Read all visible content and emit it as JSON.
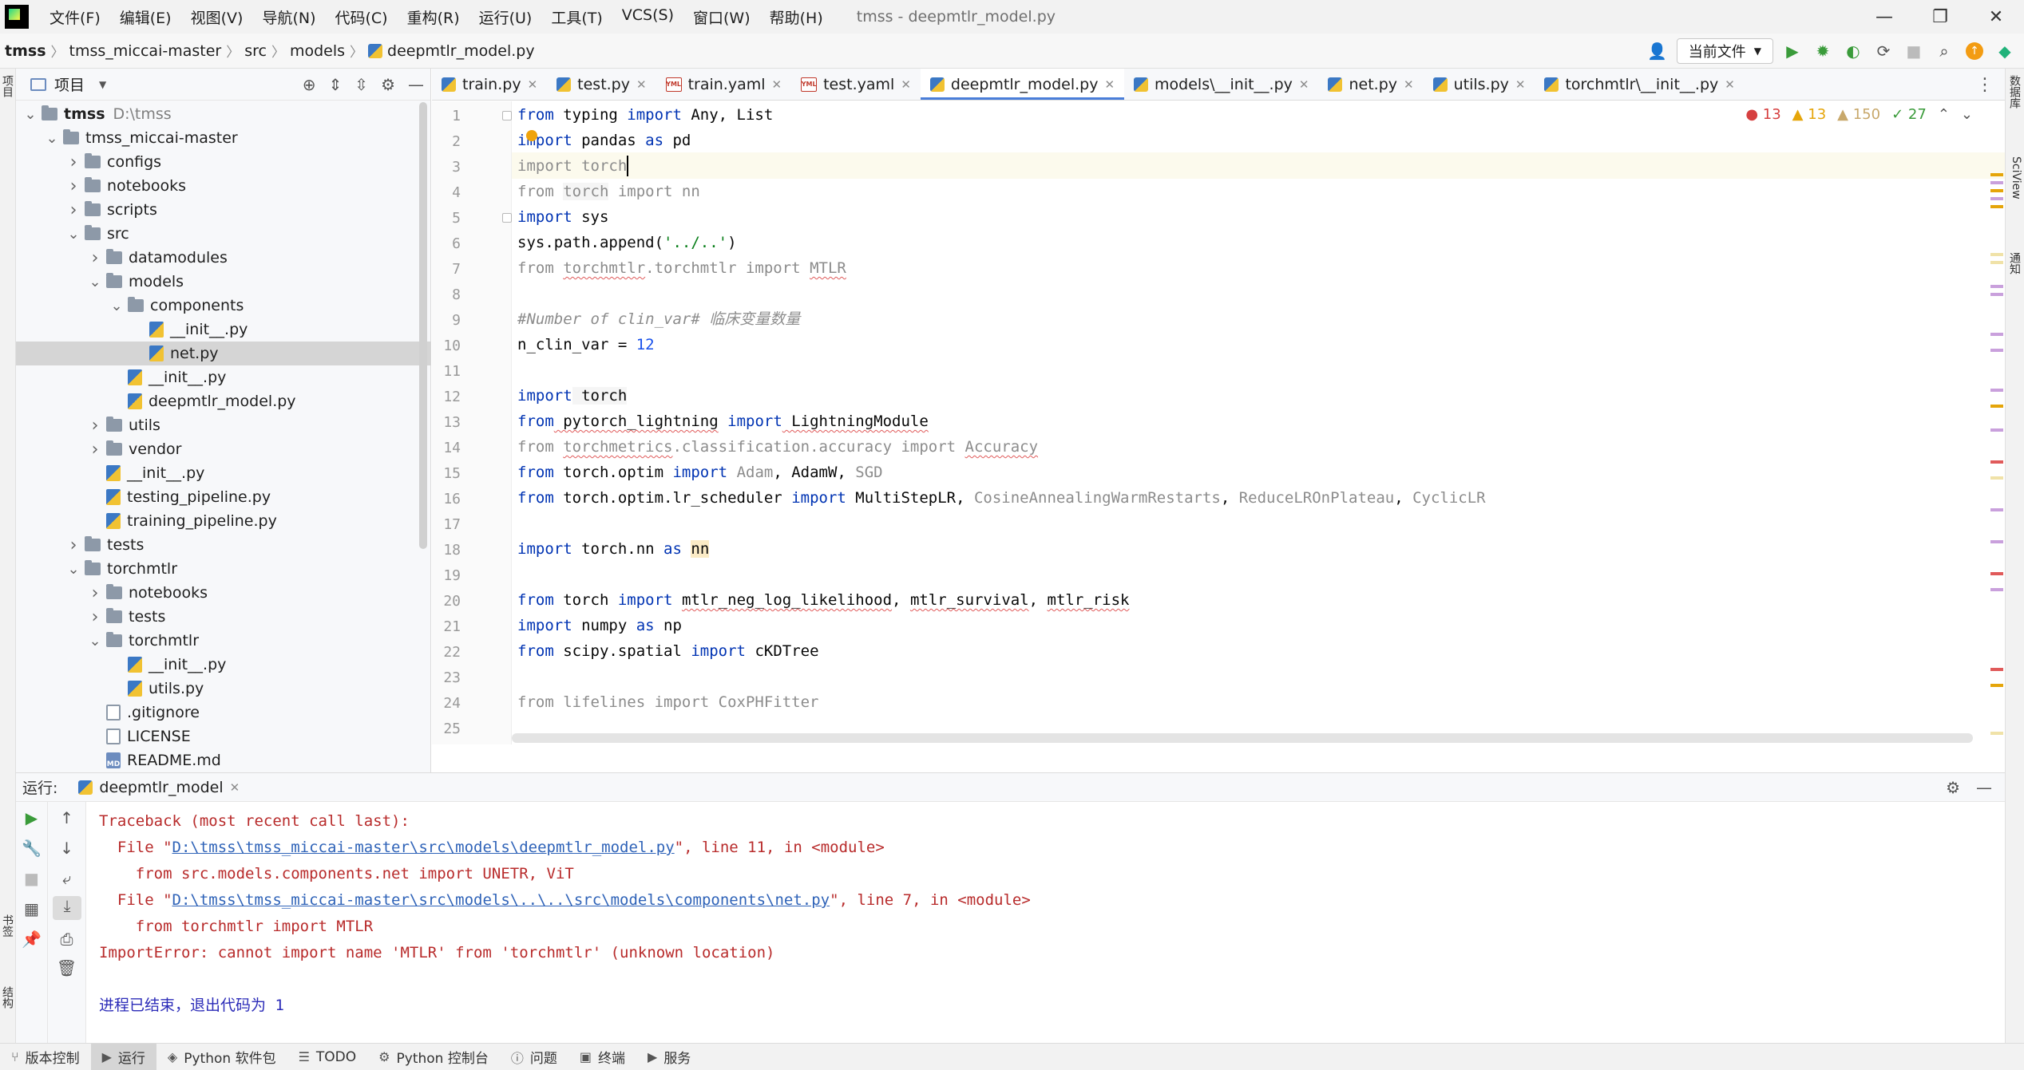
{
  "window": {
    "title": "tmss - deepmtlr_model.py",
    "menu": [
      "文件(F)",
      "编辑(E)",
      "视图(V)",
      "导航(N)",
      "代码(C)",
      "重构(R)",
      "运行(U)",
      "工具(T)",
      "VCS(S)",
      "窗口(W)",
      "帮助(H)"
    ],
    "controls": {
      "minimize": "—",
      "maximize": "❐",
      "close": "✕"
    }
  },
  "breadcrumb": [
    "tmss",
    "tmss_miccai-master",
    "src",
    "models",
    "deepmtlr_model.py"
  ],
  "toolbar": {
    "run_config": "当前文件",
    "icons": [
      "user-icon",
      "run-icon",
      "debug-icon",
      "coverage-icon",
      "profile-icon",
      "stop-icon",
      "search-icon",
      "update-icon",
      "plugin-icon"
    ]
  },
  "project_panel": {
    "title": "项目",
    "tree": [
      {
        "label": "tmss",
        "path": "D:\\tmss",
        "type": "folder",
        "depth": 0,
        "expanded": true,
        "bold": true
      },
      {
        "label": "tmss_miccai-master",
        "type": "folder",
        "depth": 1,
        "expanded": true
      },
      {
        "label": "configs",
        "type": "folder",
        "depth": 2,
        "expanded": false
      },
      {
        "label": "notebooks",
        "type": "folder",
        "depth": 2,
        "expanded": false
      },
      {
        "label": "scripts",
        "type": "folder",
        "depth": 2,
        "expanded": false
      },
      {
        "label": "src",
        "type": "folder",
        "depth": 2,
        "expanded": true
      },
      {
        "label": "datamodules",
        "type": "folder",
        "depth": 3,
        "expanded": false
      },
      {
        "label": "models",
        "type": "folder",
        "depth": 3,
        "expanded": true
      },
      {
        "label": "components",
        "type": "folder",
        "depth": 4,
        "expanded": true
      },
      {
        "label": "__init__.py",
        "type": "py",
        "depth": 5
      },
      {
        "label": "net.py",
        "type": "py",
        "depth": 5,
        "selected": true
      },
      {
        "label": "__init__.py",
        "type": "py",
        "depth": 4
      },
      {
        "label": "deepmtlr_model.py",
        "type": "py",
        "depth": 4
      },
      {
        "label": "utils",
        "type": "folder",
        "depth": 3,
        "expanded": false
      },
      {
        "label": "vendor",
        "type": "folder",
        "depth": 3,
        "expanded": false
      },
      {
        "label": "__init__.py",
        "type": "py",
        "depth": 3
      },
      {
        "label": "testing_pipeline.py",
        "type": "py",
        "depth": 3
      },
      {
        "label": "training_pipeline.py",
        "type": "py",
        "depth": 3
      },
      {
        "label": "tests",
        "type": "folder",
        "depth": 2,
        "expanded": false
      },
      {
        "label": "torchmtlr",
        "type": "folder",
        "depth": 2,
        "expanded": true
      },
      {
        "label": "notebooks",
        "type": "folder",
        "depth": 3,
        "expanded": false
      },
      {
        "label": "tests",
        "type": "folder",
        "depth": 3,
        "expanded": false
      },
      {
        "label": "torchmtlr",
        "type": "folder",
        "depth": 3,
        "expanded": true
      },
      {
        "label": "__init__.py",
        "type": "py",
        "depth": 4
      },
      {
        "label": "utils.py",
        "type": "py",
        "depth": 4
      },
      {
        "label": ".gitignore",
        "type": "txt",
        "depth": 3
      },
      {
        "label": "LICENSE",
        "type": "txt",
        "depth": 3
      },
      {
        "label": "README.md",
        "type": "md",
        "depth": 3
      }
    ]
  },
  "tabs": [
    {
      "label": "train.py",
      "kind": "py"
    },
    {
      "label": "test.py",
      "kind": "py"
    },
    {
      "label": "train.yaml",
      "kind": "yaml"
    },
    {
      "label": "test.yaml",
      "kind": "yaml"
    },
    {
      "label": "deepmtlr_model.py",
      "kind": "py",
      "active": true
    },
    {
      "label": "models\\__init__.py",
      "kind": "py"
    },
    {
      "label": "net.py",
      "kind": "py"
    },
    {
      "label": "utils.py",
      "kind": "py"
    },
    {
      "label": "torchmtlr\\__init__.py",
      "kind": "py"
    }
  ],
  "editor": {
    "inspections": {
      "errors": "13",
      "warnings": "13",
      "weak_warnings": "150",
      "typos": "27"
    },
    "lines": [
      [
        [
          "kw",
          "from"
        ],
        [
          "",
          " typing "
        ],
        [
          "kw",
          "import"
        ],
        [
          "",
          " Any, List"
        ]
      ],
      [
        [
          "kw",
          "import"
        ],
        [
          "",
          " pandas "
        ],
        [
          "kw",
          "as"
        ],
        [
          "",
          " pd"
        ]
      ],
      [
        [
          "dim",
          "import torch"
        ]
      ],
      [
        [
          "dim",
          "from "
        ],
        [
          "dimhl",
          "torch"
        ],
        [
          "dim",
          " import nn"
        ]
      ],
      [
        [
          "kw",
          "import"
        ],
        [
          "",
          " sys"
        ]
      ],
      [
        [
          "",
          "sys.path.append("
        ],
        [
          "str",
          "'../..'"
        ],
        [
          "",
          ")"
        ]
      ],
      [
        [
          "dim",
          "from "
        ],
        [
          "dimwavy",
          "torchmtlr"
        ],
        [
          "dim",
          ".torchmtlr import "
        ],
        [
          "dimwavy",
          "MTLR"
        ]
      ],
      [
        [
          "",
          ""
        ]
      ],
      [
        [
          "cmt",
          "#Number of clin_var# 临床变量数量"
        ]
      ],
      [
        [
          "",
          "n_clin_var = "
        ],
        [
          "num",
          "12"
        ]
      ],
      [
        [
          "",
          ""
        ]
      ],
      [
        [
          "kw",
          "import"
        ],
        [
          "hl",
          " torch"
        ]
      ],
      [
        [
          "kw",
          "from"
        ],
        [
          "wavy",
          " pytorch_lightning"
        ],
        [
          "",
          " "
        ],
        [
          "kw",
          "import"
        ],
        [
          "wavy",
          " LightningModule"
        ]
      ],
      [
        [
          "dim",
          "from "
        ],
        [
          "dimwavy",
          "torchmetrics"
        ],
        [
          "dim",
          ".classification.accuracy import "
        ],
        [
          "dimwavy",
          "Accuracy"
        ]
      ],
      [
        [
          "kw",
          "from"
        ],
        [
          "",
          " torch.optim "
        ],
        [
          "kw",
          "import"
        ],
        [
          "dim",
          " Adam"
        ],
        [
          "",
          ", AdamW, "
        ],
        [
          "dim",
          "SGD"
        ]
      ],
      [
        [
          "kw",
          "from"
        ],
        [
          "",
          " torch.optim.lr_scheduler "
        ],
        [
          "kw",
          "import"
        ],
        [
          "",
          " MultiStepLR, "
        ],
        [
          "dim",
          "CosineAnnealingWarmRestarts"
        ],
        [
          "",
          ", "
        ],
        [
          "dim",
          "ReduceLROnPlateau"
        ],
        [
          "",
          ", "
        ],
        [
          "dim",
          "CyclicLR"
        ]
      ],
      [
        [
          "",
          ""
        ]
      ],
      [
        [
          "kw",
          "import"
        ],
        [
          "",
          " torch.nn "
        ],
        [
          "kw",
          "as"
        ],
        [
          "",
          " "
        ],
        [
          "nnhl",
          "nn"
        ]
      ],
      [
        [
          "",
          ""
        ]
      ],
      [
        [
          "kw",
          "from"
        ],
        [
          "",
          " torch "
        ],
        [
          "kw",
          "import"
        ],
        [
          "",
          " "
        ],
        [
          "wavy",
          "mtlr_neg_log_likelihood"
        ],
        [
          "",
          ", "
        ],
        [
          "wavy",
          "mtlr_survival"
        ],
        [
          "",
          ", "
        ],
        [
          "wavy",
          "mtlr_risk"
        ]
      ],
      [
        [
          "kw",
          "import"
        ],
        [
          "",
          " numpy "
        ],
        [
          "kw",
          "as"
        ],
        [
          "",
          " np"
        ]
      ],
      [
        [
          "kw",
          "from"
        ],
        [
          "",
          " scipy.spatial "
        ],
        [
          "kw",
          "import"
        ],
        [
          "",
          " cKDTree"
        ]
      ],
      [
        [
          "",
          ""
        ]
      ],
      [
        [
          "dim",
          "from lifelines import CoxPHFitter"
        ]
      ]
    ]
  },
  "run_panel": {
    "label": "运行:",
    "tab": "deepmtlr_model",
    "console": [
      {
        "kind": "err",
        "parts": [
          [
            "",
            "Traceback (most recent call last):"
          ]
        ]
      },
      {
        "kind": "err",
        "parts": [
          [
            "",
            "  File \""
          ],
          [
            "link",
            "D:\\tmss\\tmss_miccai-master\\src\\models\\deepmtlr_model.py"
          ],
          [
            "",
            "\", line 11, in <module>"
          ]
        ]
      },
      {
        "kind": "err",
        "parts": [
          [
            "",
            "    from src.models.components.net import UNETR, ViT"
          ]
        ]
      },
      {
        "kind": "err",
        "parts": [
          [
            "",
            "  File \""
          ],
          [
            "link",
            "D:\\tmss\\tmss_miccai-master\\src\\models\\..\\..\\src\\models\\components\\net.py"
          ],
          [
            "",
            "\", line 7, in <module>"
          ]
        ]
      },
      {
        "kind": "err",
        "parts": [
          [
            "",
            "    from torchmtlr import MTLR"
          ]
        ]
      },
      {
        "kind": "err",
        "parts": [
          [
            "",
            "ImportError: cannot import name 'MTLR' from 'torchmtlr' (unknown location)"
          ]
        ]
      },
      {
        "kind": "blank",
        "parts": [
          [
            "",
            ""
          ]
        ]
      },
      {
        "kind": "info",
        "parts": [
          [
            "",
            "进程已结束，退出代码为 1"
          ]
        ]
      }
    ]
  },
  "bottom_tools": [
    {
      "label": "版本控制",
      "icon": "vcs-icon"
    },
    {
      "label": "运行",
      "icon": "run-icon",
      "active": true
    },
    {
      "label": "Python 软件包",
      "icon": "packages-icon"
    },
    {
      "label": "TODO",
      "icon": "todo-icon"
    },
    {
      "label": "Python 控制台",
      "icon": "console-icon"
    },
    {
      "label": "问题",
      "icon": "problems-icon"
    },
    {
      "label": "终端",
      "icon": "terminal-icon"
    },
    {
      "label": "服务",
      "icon": "services-icon"
    }
  ],
  "side_labels": {
    "left": [
      "项目",
      "书签",
      "结构"
    ],
    "right": [
      "数据库",
      "SciView",
      "通知"
    ]
  }
}
